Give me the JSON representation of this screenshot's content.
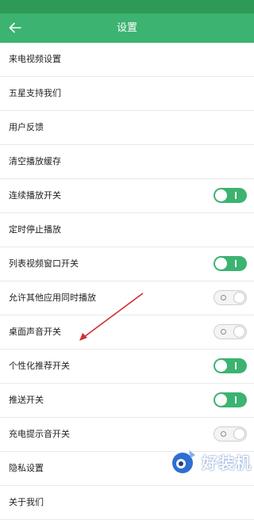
{
  "header": {
    "title": "设置",
    "back_icon": "arrow-left-icon"
  },
  "colors": {
    "primary": "#3cb371",
    "status_bar": "#2e9a57",
    "toggle_off": "#f4f4f4",
    "annotation": "#d32f2f"
  },
  "settings": [
    {
      "label": "来电视频设置"
    },
    {
      "label": "五星支持我们"
    },
    {
      "label": "用户反馈"
    },
    {
      "label": "清空播放缓存"
    },
    {
      "label": "连续播放开关",
      "toggle": "on"
    },
    {
      "label": "定时停止播放"
    },
    {
      "label": "列表视频窗口开关",
      "toggle": "on"
    },
    {
      "label": "允许其他应用同时播放",
      "toggle": "off"
    },
    {
      "label": "桌面声音开关",
      "toggle": "off"
    },
    {
      "label": "个性化推荐开关",
      "toggle": "on"
    },
    {
      "label": "推送开关",
      "toggle": "on"
    },
    {
      "label": "充电提示音开关",
      "toggle": "off"
    },
    {
      "label": "隐私设置"
    },
    {
      "label": "关于我们"
    }
  ],
  "watermark": {
    "text": "好装机"
  }
}
